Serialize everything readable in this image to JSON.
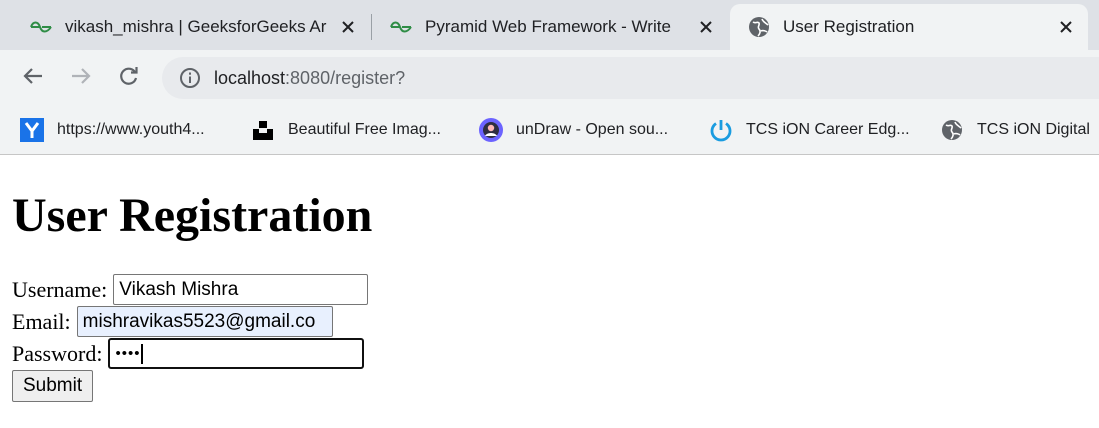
{
  "browser": {
    "tabs": [
      {
        "title": "vikash_mishra | GeeksforGeeks Ar",
        "favicon": "gfg-icon",
        "active": false
      },
      {
        "title": "Pyramid Web Framework - Write",
        "favicon": "gfg-icon",
        "active": false
      },
      {
        "title": "User Registration",
        "favicon": "globe-icon",
        "active": true
      }
    ],
    "url_host": "localhost",
    "url_path": ":8080/register?",
    "bookmarks": [
      {
        "label": "https://www.youth4...",
        "icon": "youth4work-icon"
      },
      {
        "label": "Beautiful Free Imag...",
        "icon": "unsplash-icon"
      },
      {
        "label": "unDraw - Open sou...",
        "icon": "undraw-icon"
      },
      {
        "label": "TCS iON Career Edg...",
        "icon": "tcs-power-icon"
      },
      {
        "label": "TCS iON Digital",
        "icon": "globe-icon"
      }
    ],
    "colors": {
      "gfg_green": "#2f8d46",
      "youth4_blue": "#1a73e8",
      "tcs_blue": "#1a9ce0"
    }
  },
  "page": {
    "title": "User Registration",
    "form": {
      "username_label": "Username:",
      "username_value": "Vikash Mishra",
      "email_label": "Email:",
      "email_value": "mishravikas5523@gmail.co",
      "password_label": "Password:",
      "password_mask": "••••",
      "submit_label": "Submit"
    }
  }
}
